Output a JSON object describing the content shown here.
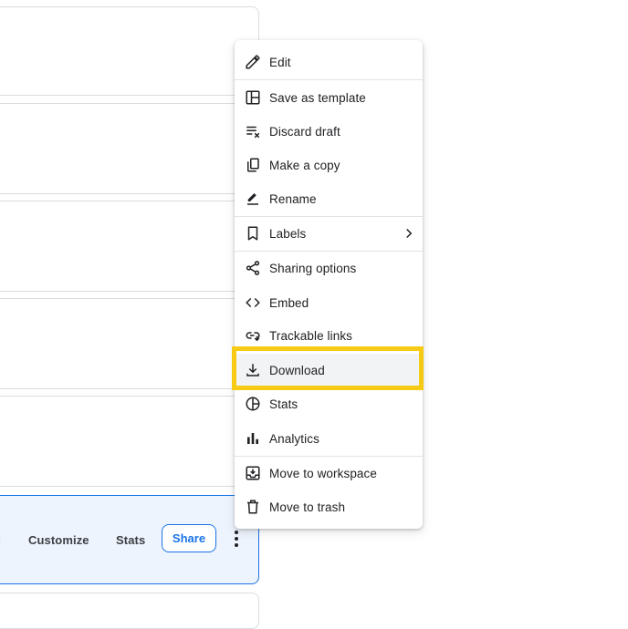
{
  "card_bar": {
    "customize_label": "Customize",
    "stats_label": "Stats",
    "share_label": "Share",
    "more_icon": "more-vert-icon"
  },
  "menu": {
    "items": [
      {
        "label": "Edit",
        "icon": "pencil-icon"
      },
      {
        "label": "Save as template",
        "icon": "template-icon"
      },
      {
        "label": "Discard draft",
        "icon": "discard-icon"
      },
      {
        "label": "Make a copy",
        "icon": "copy-icon"
      },
      {
        "label": "Rename",
        "icon": "rename-icon"
      },
      {
        "label": "Labels",
        "icon": "bookmark-icon",
        "submenu": true
      },
      {
        "label": "Sharing options",
        "icon": "share-icon"
      },
      {
        "label": "Embed",
        "icon": "code-icon"
      },
      {
        "label": "Trackable links",
        "icon": "link-icon"
      },
      {
        "label": "Download",
        "icon": "download-icon",
        "highlighted": true
      },
      {
        "label": "Stats",
        "icon": "pie-chart-icon"
      },
      {
        "label": "Analytics",
        "icon": "bar-chart-icon"
      },
      {
        "label": "Move to workspace",
        "icon": "move-to-inbox-icon"
      },
      {
        "label": "Move to trash",
        "icon": "trash-icon"
      }
    ]
  },
  "colors": {
    "accent": "#1a73e8",
    "active_card_bg": "#eef4fd",
    "highlight_border": "#f7cb15"
  }
}
